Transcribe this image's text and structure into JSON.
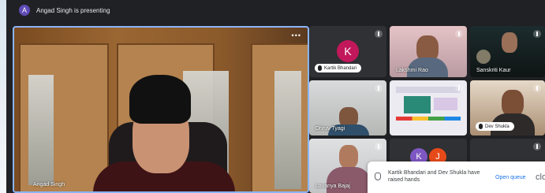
{
  "presenter": {
    "avatar_letter": "A",
    "text": "Angad Singh is presenting"
  },
  "main_tile": {
    "name": "Angad Singh",
    "more_icon": "more-vert-icon"
  },
  "tiles": [
    {
      "name": "Kartik Bhandari",
      "avatar_letter": "K",
      "avatar_color": "#c2185b"
    },
    {
      "name": "Lakshmi Rao"
    },
    {
      "name": "Sanskriti Kaur"
    },
    {
      "name": "Dhruv Tyagi"
    },
    {
      "name": "Dev Shukla"
    },
    {
      "name": "Lavanya Bajaj"
    },
    {
      "name": "K J",
      "avatar_letters": [
        "K",
        "J"
      ],
      "avatar_colors": [
        "#7e57c2",
        "#e64a19"
      ]
    }
  ],
  "notification": {
    "message": "Kartik Bhandari and Dev Shukla have raised hands",
    "open_label": "Open queue",
    "close_label": "clo"
  }
}
